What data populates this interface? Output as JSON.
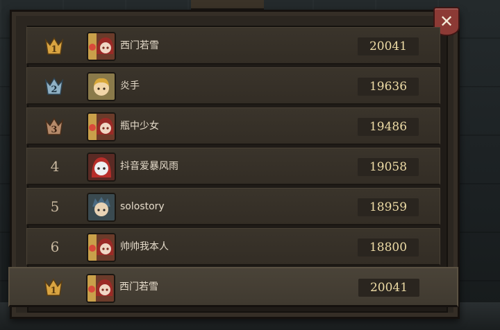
{
  "leaderboard": {
    "close_label": "✕",
    "rows": [
      {
        "rank": "1",
        "name": "西门若雪",
        "score": "20041"
      },
      {
        "rank": "2",
        "name": "炎手",
        "score": "19636"
      },
      {
        "rank": "3",
        "name": "瓶中少女",
        "score": "19486"
      },
      {
        "rank": "4",
        "name": "抖音爱暴风雨",
        "score": "19058"
      },
      {
        "rank": "5",
        "name": "solostory",
        "score": "18959"
      },
      {
        "rank": "6",
        "name": "帅帅我本人",
        "score": "18800"
      }
    ],
    "self": {
      "rank": "1",
      "name": "西门若雪",
      "score": "20041"
    }
  },
  "colors": {
    "gold_medal": "#d9a441",
    "silver_medal": "#8fb0c4",
    "bronze_medal": "#b58a6a",
    "score_text": "#eedca6",
    "close_button": "#8c3a35"
  },
  "icons": {
    "medal_1": "gold-crown-medal-icon",
    "medal_2": "silver-crown-medal-icon",
    "medal_3": "bronze-crown-medal-icon",
    "close": "close-icon"
  }
}
